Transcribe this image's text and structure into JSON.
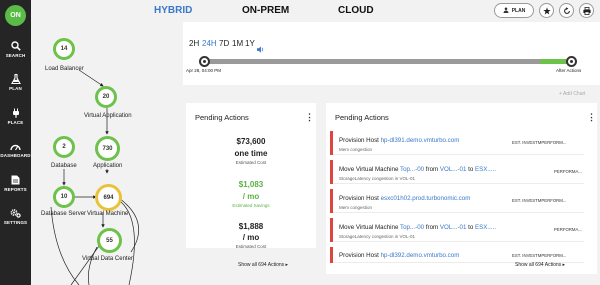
{
  "sidebar": {
    "logo": "ON",
    "items": [
      {
        "label": "SEARCH",
        "icon": "search-icon"
      },
      {
        "label": "PLAN",
        "icon": "flask-icon"
      },
      {
        "label": "PLACE",
        "icon": "plug-icon"
      },
      {
        "label": "DASHBOARD",
        "icon": "dashboard-icon"
      },
      {
        "label": "REPORTS",
        "icon": "report-icon"
      },
      {
        "label": "SETTINGS",
        "icon": "gears-icon"
      }
    ]
  },
  "topnav": {
    "tabs": [
      {
        "label": "HYBRID",
        "active": true
      },
      {
        "label": "ON-PREM",
        "active": false
      },
      {
        "label": "CLOUD",
        "active": false
      }
    ],
    "plan_label": "PLAN",
    "accent": "#3a79c8"
  },
  "topology": {
    "nodes": [
      {
        "value": "14",
        "label": "Load Balancer"
      },
      {
        "value": "20",
        "label": "Virtual Application"
      },
      {
        "value": "730",
        "label": "Application"
      },
      {
        "value": "2",
        "label": "Database"
      },
      {
        "value": "10",
        "label": "Database Server"
      },
      {
        "value": "694",
        "label": "Virtual Machine"
      },
      {
        "value": "55",
        "label": "Virtual Data Center"
      }
    ],
    "ring_color": "#6cc24a"
  },
  "timeline": {
    "options": [
      "2H",
      "24H",
      "7D",
      "1M",
      "1Y"
    ],
    "selected": "24H",
    "start_label": "Apr 28, 04:00 PM",
    "end_label": "After Actions",
    "add_chart": "+ Add Chart"
  },
  "pending_summary": {
    "title": "Pending Actions",
    "stats": [
      {
        "value": "$73,600",
        "value2": "one time",
        "caption": "Estimated Cost",
        "color": "#222222"
      },
      {
        "value": "$1,083",
        "value2": "/ mo",
        "caption": "Estimated Savings",
        "color": "#5bb145"
      },
      {
        "value": "$1,888",
        "value2": "/ mo",
        "caption": "Estimated Cost",
        "color": "#222222"
      }
    ],
    "show_all": "Show all 694 Actions"
  },
  "pending_list": {
    "title": "Pending Actions",
    "actions": [
      {
        "prefix": "Provision Host ",
        "link1": "hp-dl391.demo.vmturbo.com",
        "mid": "",
        "link2": "",
        "mid2": "",
        "link3": "",
        "detail": "Mem congestion",
        "tag": "EST. INVESTMPERFORM..."
      },
      {
        "prefix": "Move Virtual Machine ",
        "link1": "Top...-00",
        "mid": " from ",
        "link2": "VOL...-01",
        "mid2": " to ",
        "link3": "ESX.....",
        "detail": "StorageLatency congestion in VOL-01",
        "tag": "PERFORMA..."
      },
      {
        "prefix": "Provision Host ",
        "link1": "esxc01h02.prod.turbonomic.com",
        "mid": "",
        "link2": "",
        "mid2": "",
        "link3": "",
        "detail": "Mem congestion",
        "tag": "EST. INVESTMPERFORM..."
      },
      {
        "prefix": "Move Virtual Machine ",
        "link1": "Top...-00",
        "mid": " from ",
        "link2": "VOL...-01",
        "mid2": " to ",
        "link3": "ESX.....",
        "detail": "StorageLatency congestion in VOL-01",
        "tag": "PERFORMA..."
      },
      {
        "prefix": "Provision Host ",
        "link1": "hp-dl392.demo.vmturbo.com",
        "mid": "",
        "link2": "",
        "mid2": "",
        "link3": "",
        "detail": "",
        "tag": "EST. INVESTMPERFORM..."
      }
    ],
    "show_all": "Show all 694 Actions",
    "status_color": "#e0443e"
  }
}
